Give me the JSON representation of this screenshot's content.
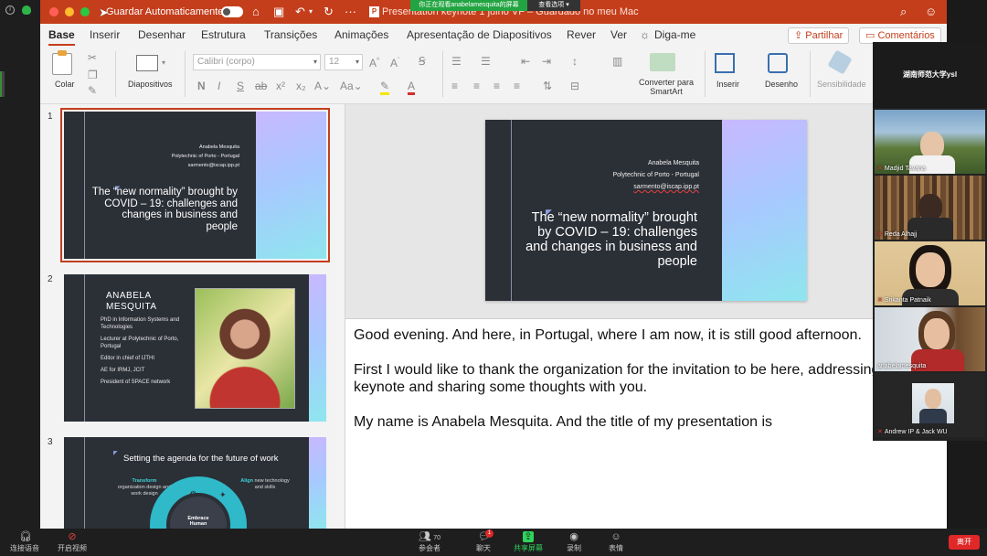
{
  "zoom": {
    "banner_viewing": "你正在观看anabelamesquita的屏幕",
    "banner_options": "查看选项",
    "panel_title": "湖南师范大学ysl",
    "participants": [
      {
        "name": "Madjid Tavana"
      },
      {
        "name": "Reda Alhajj"
      },
      {
        "name": "Srikanta Patnaik"
      },
      {
        "name": "anabelamesquita"
      },
      {
        "name": "Andrew IP & Jack WU"
      }
    ],
    "toolbar": {
      "audio": "连接语音",
      "video": "开启视频",
      "participants_label": "参会者",
      "participants_count": "70",
      "chat": "聊天",
      "chat_badge": "1",
      "share": "共享屏幕",
      "record": "录制",
      "reactions": "表情",
      "leave": "离开"
    }
  },
  "ppt": {
    "autosave_label": "Guardar Automaticamente",
    "document_title": "Presentation keynote 1 julho VF – Guardado no meu Mac",
    "menu": [
      "Base",
      "Inserir",
      "Desenhar",
      "Estrutura",
      "Transições",
      "Animações",
      "Apresentação de Diapositivos",
      "Rever",
      "Ver",
      "Diga-me"
    ],
    "share_button": "Partilhar",
    "comments_button": "Comentários",
    "ribbon": {
      "paste": "Colar",
      "slides": "Diapositivos",
      "font_name": "Calibri (corpo)",
      "font_size": "12",
      "convert_smartart": "Converter para SmartArt",
      "insert": "Inserir",
      "drawing": "Desenho",
      "sensitivity": "Sensibilidade"
    },
    "slides": [
      {
        "number": "1",
        "author": "Anabela Mesquita",
        "institution": "Polytechnic of Porto - Portugal",
        "email": "sarmento@iscap.ipp.pt",
        "title": "The “new normality” brought by COVID – 19: challenges and changes in business and people"
      },
      {
        "number": "2",
        "heading": "ANABELA MESQUITA",
        "bullets": [
          "PhD in Information Systems and Technologies",
          "Lecturer at Polytechnic of Porto, Portugal",
          "Editor in chief of IJTHI",
          "AE for IRMJ, JCIT",
          "President of SPACE network"
        ]
      },
      {
        "number": "3",
        "title": "Setting the agenda for the future of work",
        "transform_word": "Transform",
        "transform_text": "organization design and work design",
        "align_word": "Align",
        "align_text": "new technology and skills",
        "embrace_text": "Embrace Human"
      }
    ],
    "notes": [
      "Good evening. And here, in Portugal, where I am now, it is still good afternoon.",
      "First I would like to thank the organization for the invitation to be here, addressing this keynote and sharing some thoughts with you.",
      "My name is Anabela Mesquita. And the title of my presentation is"
    ]
  }
}
